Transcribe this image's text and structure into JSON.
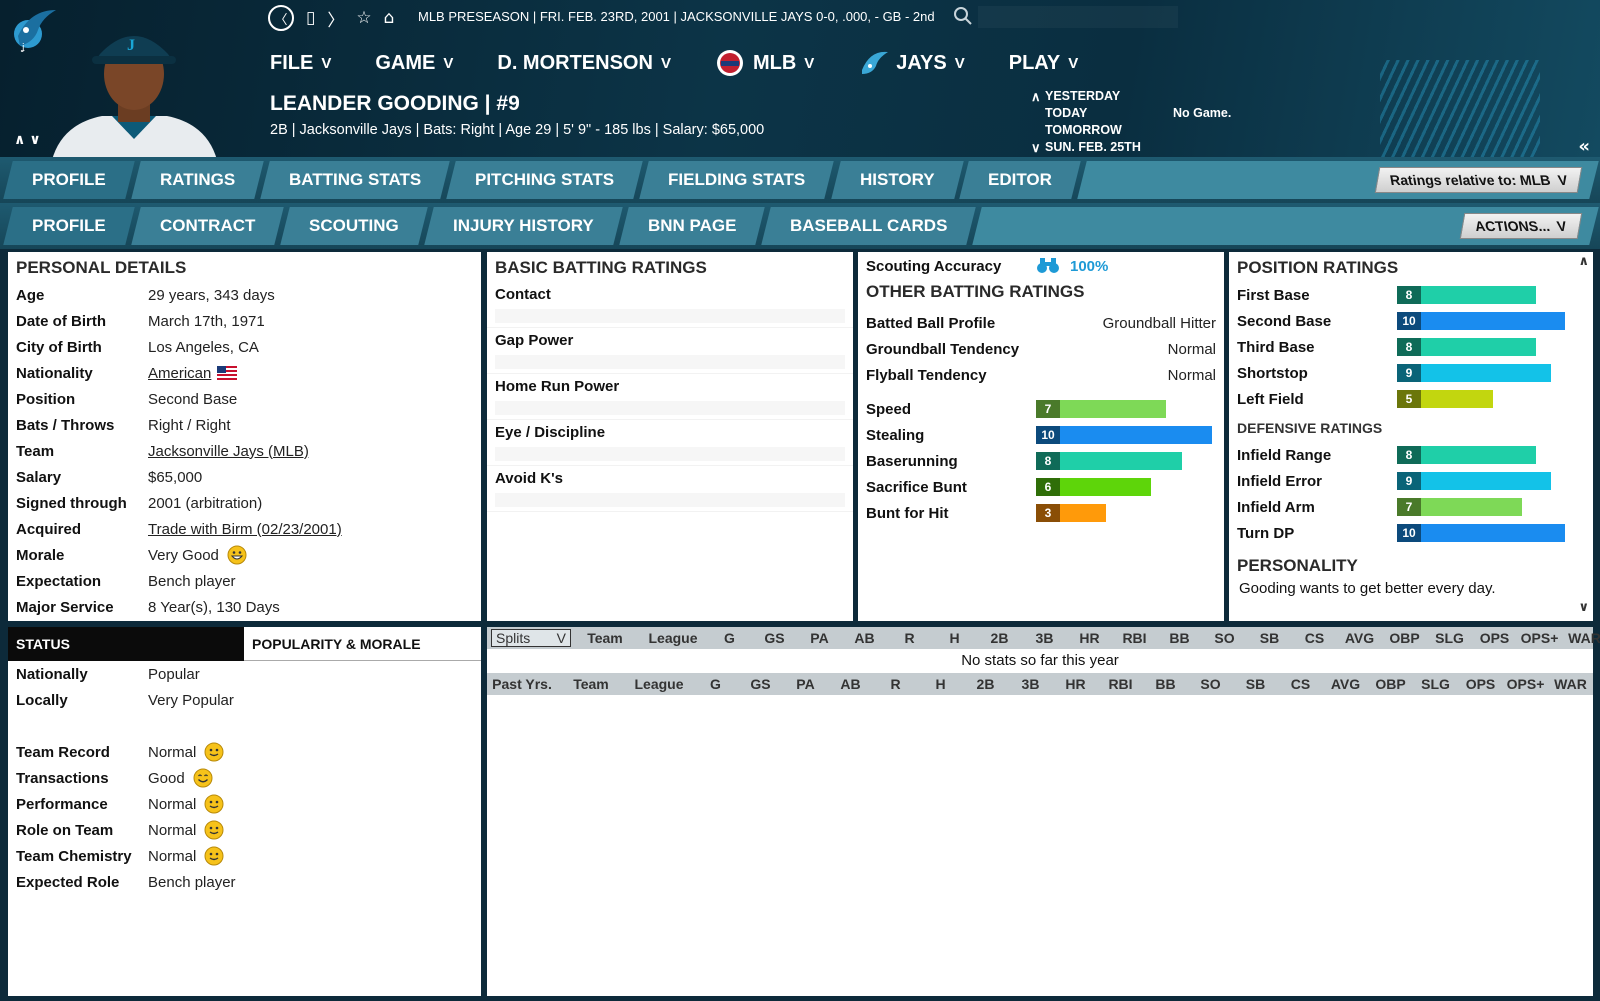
{
  "header": {
    "status_line": "MLB PRESEASON  |  FRI. FEB. 23RD, 2001  |  JACKSONVILLE JAYS  0-0, .000, - GB - 2nd",
    "menu": [
      {
        "label": "FILE"
      },
      {
        "label": "GAME"
      },
      {
        "label": "D. MORTENSON"
      },
      {
        "label": "MLB"
      },
      {
        "label": "JAYS"
      },
      {
        "label": "PLAY"
      }
    ],
    "chevron": "V",
    "player_name": "LEANDER GOODING  |  #9",
    "player_info": "2B | Jacksonville Jays  |  Bats: Right  |  Age 29  |  5' 9\" - 185 lbs  |  Salary: $65,000",
    "schedule": {
      "yesterday": "YESTERDAY",
      "today": "TODAY",
      "tomorrow": "TOMORROW",
      "next": "SUN. FEB. 25TH",
      "today_result": "No Game."
    },
    "collapse": "«"
  },
  "tabs_main": [
    "PROFILE",
    "RATINGS",
    "BATTING STATS",
    "PITCHING STATS",
    "FIELDING STATS",
    "HISTORY",
    "EDITOR"
  ],
  "ratings_relative": "Ratings relative to: MLB",
  "tabs_sub": [
    "PROFILE",
    "CONTRACT",
    "SCOUTING",
    "INJURY HISTORY",
    "BNN PAGE",
    "BASEBALL CARDS"
  ],
  "actions_label": "ACTIONS...",
  "personal": {
    "title": "PERSONAL DETAILS",
    "rows": [
      {
        "k": "Age",
        "v": "29 years, 343 days"
      },
      {
        "k": "Date of Birth",
        "v": "March 17th, 1971"
      },
      {
        "k": "City of Birth",
        "v": "Los Angeles, CA"
      },
      {
        "k": "Nationality",
        "v": "American"
      },
      {
        "k": "Position",
        "v": "Second Base"
      },
      {
        "k": "Bats / Throws",
        "v": "Right / Right"
      },
      {
        "k": "Team",
        "v": "Jacksonville Jays (MLB)"
      },
      {
        "k": "Salary",
        "v": "$65,000"
      },
      {
        "k": "Signed through",
        "v": "2001 (arbitration)"
      },
      {
        "k": "Acquired",
        "v": "Trade with Birm (02/23/2001)"
      },
      {
        "k": "Morale",
        "v": "Very Good"
      },
      {
        "k": "Expectation",
        "v": "Bench player"
      },
      {
        "k": "Major Service",
        "v": "8 Year(s), 130 Days"
      }
    ]
  },
  "basic_batting": {
    "title": "BASIC BATTING RATINGS",
    "rows": [
      "Contact",
      "Gap Power",
      "Home Run Power",
      "Eye / Discipline",
      "Avoid K's"
    ]
  },
  "other_batting": {
    "scouting_label": "Scouting Accuracy",
    "scouting_value": "100%",
    "title": "OTHER BATTING RATINGS",
    "text_rows": [
      {
        "k": "Batted Ball Profile",
        "v": "Groundball Hitter"
      },
      {
        "k": "Groundball Tendency",
        "v": "Normal"
      },
      {
        "k": "Flyball Tendency",
        "v": "Normal"
      }
    ],
    "bar_rows": [
      {
        "k": "Speed",
        "v": 7,
        "color": "#7ed957",
        "numcolor": "#4a7a2a"
      },
      {
        "k": "Stealing",
        "v": 10,
        "color": "#1a8cf0",
        "numcolor": "#0c4a7c"
      },
      {
        "k": "Baserunning",
        "v": 8,
        "color": "#1fcfa8",
        "numcolor": "#0f6b58"
      },
      {
        "k": "Sacrifice Bunt",
        "v": 6,
        "color": "#5ed50a",
        "numcolor": "#2f6e08"
      },
      {
        "k": "Bunt for Hit",
        "v": 3,
        "color": "#ff9a0a",
        "numcolor": "#8a4e06"
      }
    ]
  },
  "position": {
    "title": "POSITION RATINGS",
    "rows": [
      {
        "k": "First Base",
        "v": 8,
        "color": "#1fcfa8",
        "numcolor": "#0f6b58"
      },
      {
        "k": "Second Base",
        "v": 10,
        "color": "#1a8cf0",
        "numcolor": "#0c4a7c"
      },
      {
        "k": "Third Base",
        "v": 8,
        "color": "#1fcfa8",
        "numcolor": "#0f6b58"
      },
      {
        "k": "Shortstop",
        "v": 9,
        "color": "#13c2e8",
        "numcolor": "#0a6478"
      },
      {
        "k": "Left Field",
        "v": 5,
        "color": "#c2d60f",
        "numcolor": "#6b760a"
      }
    ],
    "def_title": "DEFENSIVE RATINGS",
    "def_rows": [
      {
        "k": "Infield Range",
        "v": 8,
        "color": "#1fcfa8",
        "numcolor": "#0f6b58"
      },
      {
        "k": "Infield Error",
        "v": 9,
        "color": "#13c2e8",
        "numcolor": "#0a6478"
      },
      {
        "k": "Infield Arm",
        "v": 7,
        "color": "#7ed957",
        "numcolor": "#4a7a2a"
      },
      {
        "k": "Turn DP",
        "v": 10,
        "color": "#1a8cf0",
        "numcolor": "#0c4a7c"
      }
    ],
    "personality_title": "PERSONALITY",
    "personality_text": "Gooding wants to get better every day."
  },
  "status": {
    "tab_status": "STATUS",
    "tab_popularity": "POPULARITY & MORALE",
    "rows": [
      {
        "k": "Nationally",
        "v": "Popular",
        "smiley": false
      },
      {
        "k": "Locally",
        "v": "Very Popular",
        "smiley": false
      },
      {
        "k": "Team Record",
        "v": "Normal",
        "smiley": true
      },
      {
        "k": "Transactions",
        "v": "Good",
        "smiley": true
      },
      {
        "k": "Performance",
        "v": "Normal",
        "smiley": true
      },
      {
        "k": "Role on Team",
        "v": "Normal",
        "smiley": true
      },
      {
        "k": "Team Chemistry",
        "v": "Normal",
        "smiley": true
      },
      {
        "k": "Expected Role",
        "v": "Bench player",
        "smiley": false
      }
    ]
  },
  "stats": {
    "splits_label": "Splits",
    "past_label": "Past Yrs.",
    "columns": [
      "Team",
      "League",
      "G",
      "GS",
      "PA",
      "AB",
      "R",
      "H",
      "2B",
      "3B",
      "HR",
      "RBI",
      "BB",
      "SO",
      "SB",
      "CS",
      "AVG",
      "OBP",
      "SLG",
      "OPS",
      "OPS+",
      "WAR"
    ],
    "empty_message": "No stats so far this year"
  }
}
